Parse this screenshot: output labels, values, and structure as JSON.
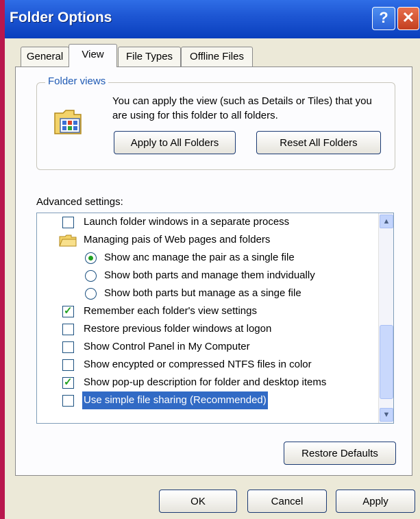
{
  "window": {
    "title": "Folder Options",
    "help_glyph": "?",
    "close_glyph": "✕"
  },
  "tabs": [
    "General",
    "View",
    "File Types",
    "Offline Files"
  ],
  "folder_views": {
    "legend": "Folder views",
    "description": "You can apply the view (such as Details or Tiles) that you are using for this folder to all folders.",
    "apply_label": "Apply to All Folders",
    "reset_label": "Reset All Folders"
  },
  "advanced": {
    "label": "Advanced settings:",
    "items": [
      {
        "kind": "checkbox",
        "checked": false,
        "label": "Launch folder windows in a separate process"
      },
      {
        "kind": "folder",
        "label": "Managing pais of Web pages and folders"
      },
      {
        "kind": "radio",
        "checked": true,
        "label": "Show anc manage the pair as a single file"
      },
      {
        "kind": "radio",
        "checked": false,
        "label": "Show both parts and manage them indvidually"
      },
      {
        "kind": "radio",
        "checked": false,
        "label": "Show both parts but manage as a singe file"
      },
      {
        "kind": "checkbox",
        "checked": true,
        "label": "Remember each folder's view settings"
      },
      {
        "kind": "checkbox",
        "checked": false,
        "label": "Restore previous folder windows at logon"
      },
      {
        "kind": "checkbox",
        "checked": false,
        "label": "Show Control Panel in My Computer"
      },
      {
        "kind": "checkbox",
        "checked": false,
        "label": "Show encypted or compressed NTFS files in color"
      },
      {
        "kind": "checkbox",
        "checked": true,
        "label": "Show pop-up description for folder and desktop items"
      },
      {
        "kind": "checkbox",
        "checked": false,
        "selected": true,
        "label": "Use simple file sharing (Recommended)"
      }
    ],
    "restore_label": "Restore Defaults"
  },
  "footer": {
    "ok_label": "OK",
    "cancel_label": "Cancel",
    "apply_label": "Apply"
  },
  "colors": {
    "titlebar": "#0a3fbd",
    "selection": "#316ac5",
    "check": "#21a121"
  }
}
